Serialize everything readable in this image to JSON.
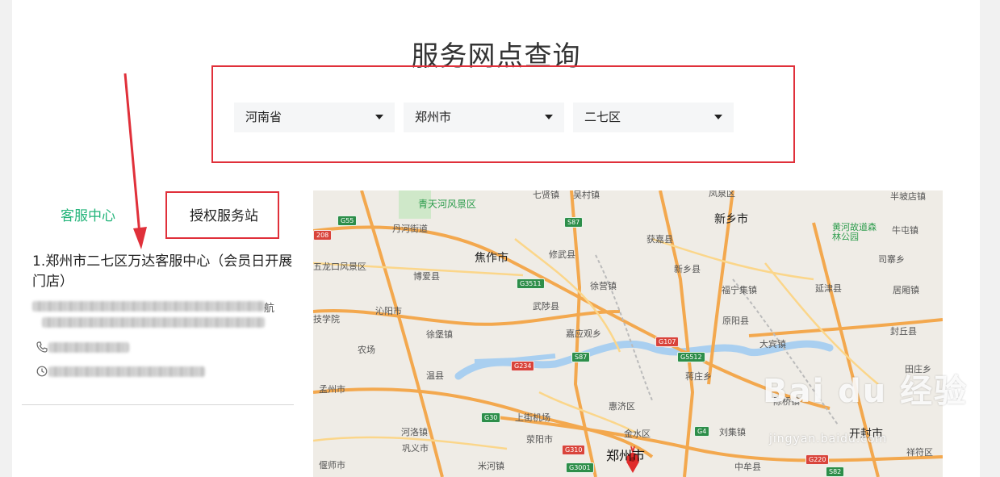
{
  "page": {
    "title": "服务网点查询"
  },
  "filters": {
    "province": "河南省",
    "city": "郑州市",
    "district": "二七区"
  },
  "tabs": {
    "customer_center": "客服中心",
    "authorized_station": "授权服务站"
  },
  "store": {
    "name": "1.郑州市二七区万达客服中心（会员日开展门店）",
    "address_suffix": "航"
  },
  "map": {
    "labels": {
      "qingtianhe": "青天河风景区",
      "danhe": "丹河街道",
      "qixian": "七贤镇",
      "wucun": "吴村镇",
      "fengquan": "凤泉区",
      "banpo": "半坡店镇",
      "xinxiang": "新乡市",
      "huanghe_park": "黄河故道森林公园",
      "niutun": "牛屯镇",
      "wulong": "五龙口风景区",
      "jiaozuo": "焦作市",
      "xiuwu": "修武县",
      "huojia": "获嘉县",
      "boai": "博爱县",
      "xinxiang_county": "新乡县",
      "simu": "司寨乡",
      "xuying": "徐营镇",
      "fuzhong": "福宁集镇",
      "yanjin": "延津县",
      "juying": "居厢镇",
      "jixue": "技学院",
      "qinyang": "沁阳市",
      "wuzhi": "武陟县",
      "yuanyang": "原阳县",
      "xubao": "徐堡镇",
      "jiaoguan": "嘉应观乡",
      "fengqiu": "封丘县",
      "nongchang": "农场",
      "dabin": "大宾镇",
      "wenxian": "温县",
      "jiangzhuang": "蒋庄乡",
      "tianzhuang": "田庄乡",
      "mengzhou": "孟州市",
      "huiji": "惠济区",
      "chendu": "陈桥镇",
      "heluo": "河洛镇",
      "shangjie": "上街机场",
      "xingyang": "荥阳市",
      "jinshui": "金水区",
      "liuji": "刘集镇",
      "kaifeng": "开封市",
      "gongyi": "巩义市",
      "zhengzhou": "郑州市",
      "yanshi": "偃师市",
      "migou": "米河镇",
      "zhongmou": "中牟县",
      "xiangfu": "祥符区"
    },
    "shields": {
      "g55": "G55",
      "s208": "208",
      "s87a": "S87",
      "g3511": "G3511",
      "g107": "G107",
      "g5512": "G5512",
      "s87b": "S87",
      "g234": "G234",
      "g30": "G30",
      "g310": "G310",
      "g4": "G4",
      "g3001": "G3001",
      "g220": "G220",
      "s82": "S82"
    }
  },
  "watermark": {
    "brand": "Bai du 经验",
    "url": "jingyan.baidu.com"
  },
  "colors": {
    "accent_green": "#23b47a",
    "highlight_red": "#e0303a",
    "map_pin": "#e02b2b"
  }
}
